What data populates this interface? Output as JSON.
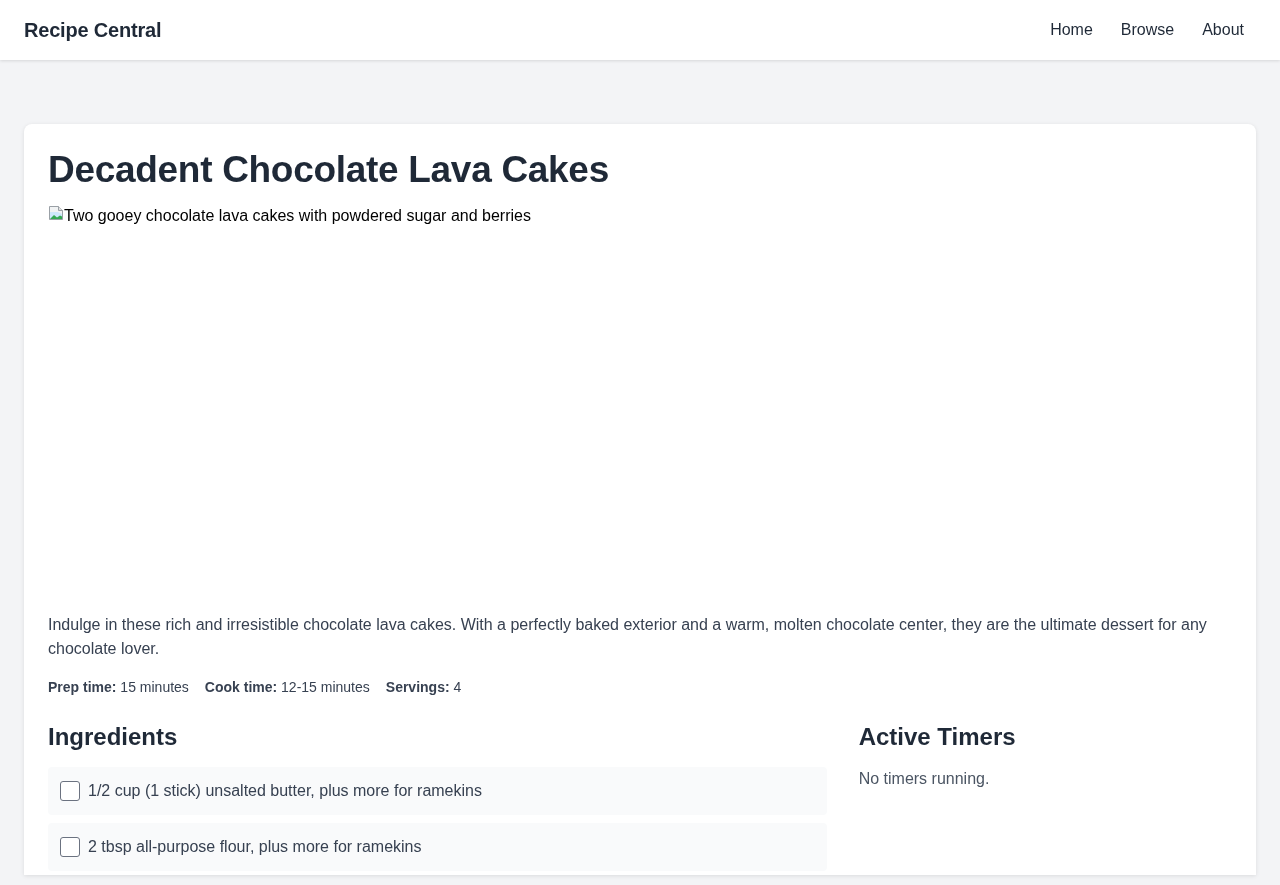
{
  "navbar": {
    "brand": "Recipe Central",
    "links": [
      "Home",
      "Browse",
      "About"
    ]
  },
  "recipe": {
    "title": "Decadent Chocolate Lava Cakes",
    "image": {
      "alt_text": "Two gooey chocolate lava cakes with powdered sugar and berries"
    },
    "description": "Indulge in these rich and irresistible chocolate lava cakes. With a perfectly baked exterior and a warm, molten chocolate center, they are the ultimate dessert for any chocolate lover.",
    "meta": [
      "**Prep time:** 15 minutes",
      "**Cook time:** 12-15 minutes",
      "**Servings:** 4"
    ]
  },
  "ingredients": {
    "heading": "Ingredients",
    "items": [
      {
        "text": "1/2 cup (1 stick) unsalted butter, plus more for ramekins",
        "checked": false
      },
      {
        "text": "2 tbsp all-purpose flour, plus more for ramekins",
        "checked": false
      }
    ]
  },
  "timers": {
    "heading": "Active Timers",
    "empty_text": "No timers running."
  }
}
